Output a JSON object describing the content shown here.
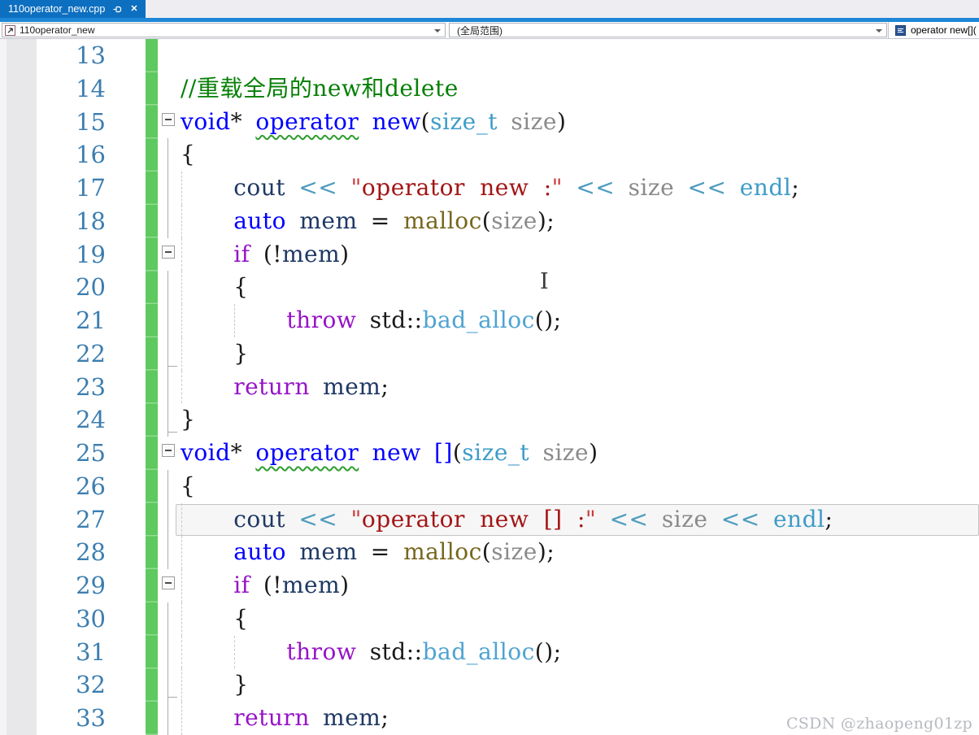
{
  "tab": {
    "title": "110operator_new.cpp",
    "pin_icon": "pin-icon",
    "close_icon": "✕"
  },
  "navbar": {
    "types_combo": {
      "value": "110operator_new",
      "icon": "cpp-file-icon"
    },
    "scope_combo": {
      "value": "(全局范围)"
    },
    "member_combo": {
      "value": "operator new[](",
      "icon": "method-icon"
    }
  },
  "watermark": {
    "text": "CSDN @zhaopeng01zp"
  },
  "colors": {
    "tab_blue": "#0D6FC0",
    "strip_blue": "#1E87D7",
    "change_bar_green": "#5EC95E",
    "line_number": "#3C7EB0",
    "keyword": "#0000FF",
    "control_keyword": "#9614C8",
    "type": "#3E9CC8",
    "class_name": "#4FA3D1",
    "parameter": "#8A8A8A",
    "variable": "#1F3864",
    "function": "#77661E",
    "operator": "#4E9CBF",
    "string": "#A31515",
    "quote": "#CC3B3B",
    "punctuation": "#1A1A1A",
    "comment": "#067F06",
    "squiggle": "#2E9E2E",
    "watermark": "#B7BAC0"
  },
  "editor": {
    "lines": [
      {
        "num": 13,
        "fold": "",
        "guides": [],
        "current": false,
        "tokens": []
      },
      {
        "num": 14,
        "fold": "",
        "guides": [],
        "current": false,
        "tokens": [
          {
            "t": "//重载全局的new和delete",
            "c": "com"
          }
        ]
      },
      {
        "num": 15,
        "fold": "box",
        "guides": [],
        "current": false,
        "tokens": [
          {
            "t": "void",
            "c": "kw"
          },
          {
            "t": "*",
            "c": "pun"
          },
          {
            "w": 1
          },
          {
            "t": "operator",
            "c": "kw",
            "u": true
          },
          {
            "w": 1
          },
          {
            "t": "new",
            "c": "kw"
          },
          {
            "t": "(",
            "c": "pun"
          },
          {
            "t": "size_t",
            "c": "type"
          },
          {
            "w": 1
          },
          {
            "t": "size",
            "c": "param"
          },
          {
            "t": ")",
            "c": "pun"
          }
        ]
      },
      {
        "num": 16,
        "fold": "line",
        "guides": [],
        "current": false,
        "tokens": [
          {
            "t": "{",
            "c": "pun"
          }
        ]
      },
      {
        "num": 17,
        "fold": "line",
        "guides": [
          1
        ],
        "current": false,
        "tokens": [
          {
            "w": 4
          },
          {
            "t": "cout",
            "c": "var"
          },
          {
            "w": 1
          },
          {
            "t": "<<",
            "c": "op"
          },
          {
            "w": 1
          },
          {
            "t": "\"",
            "c": "quo"
          },
          {
            "t": "operator new :",
            "c": "str"
          },
          {
            "t": "\"",
            "c": "quo"
          },
          {
            "w": 1
          },
          {
            "t": "<<",
            "c": "op"
          },
          {
            "w": 1
          },
          {
            "t": "size",
            "c": "param"
          },
          {
            "w": 1
          },
          {
            "t": "<<",
            "c": "op"
          },
          {
            "w": 1
          },
          {
            "t": "endl",
            "c": "type"
          },
          {
            "t": ";",
            "c": "pun"
          }
        ]
      },
      {
        "num": 18,
        "fold": "line",
        "guides": [
          1
        ],
        "current": false,
        "tokens": [
          {
            "w": 4
          },
          {
            "t": "auto",
            "c": "kw"
          },
          {
            "w": 1
          },
          {
            "t": "mem",
            "c": "var"
          },
          {
            "w": 1
          },
          {
            "t": "=",
            "c": "pun"
          },
          {
            "w": 1
          },
          {
            "t": "malloc",
            "c": "fn"
          },
          {
            "t": "(",
            "c": "pun"
          },
          {
            "t": "size",
            "c": "param"
          },
          {
            "t": ")",
            "c": "pun"
          },
          {
            "t": ";",
            "c": "pun"
          }
        ]
      },
      {
        "num": 19,
        "fold": "box",
        "guides": [
          1
        ],
        "current": false,
        "tokens": [
          {
            "w": 4
          },
          {
            "t": "if",
            "c": "ctl"
          },
          {
            "w": 1
          },
          {
            "t": "(!",
            "c": "pun"
          },
          {
            "t": "mem",
            "c": "var"
          },
          {
            "t": ")",
            "c": "pun"
          }
        ]
      },
      {
        "num": 20,
        "fold": "line",
        "guides": [
          1
        ],
        "current": false,
        "tokens": [
          {
            "w": 4
          },
          {
            "t": "{",
            "c": "pun"
          }
        ]
      },
      {
        "num": 21,
        "fold": "line",
        "guides": [
          1,
          2
        ],
        "current": false,
        "tokens": [
          {
            "w": 8
          },
          {
            "t": "throw",
            "c": "ctl"
          },
          {
            "w": 1
          },
          {
            "t": "std",
            "c": "pun"
          },
          {
            "t": "::",
            "c": "pun"
          },
          {
            "t": "bad_alloc",
            "c": "cls"
          },
          {
            "t": "()",
            "c": "pun"
          },
          {
            "t": ";",
            "c": "pun"
          }
        ]
      },
      {
        "num": 22,
        "fold": "end",
        "guides": [
          1
        ],
        "current": false,
        "tokens": [
          {
            "w": 4
          },
          {
            "t": "}",
            "c": "pun"
          }
        ]
      },
      {
        "num": 23,
        "fold": "line",
        "guides": [
          1
        ],
        "current": false,
        "tokens": [
          {
            "w": 4
          },
          {
            "t": "return",
            "c": "ctl"
          },
          {
            "w": 1
          },
          {
            "t": "mem",
            "c": "var"
          },
          {
            "t": ";",
            "c": "pun"
          }
        ]
      },
      {
        "num": 24,
        "fold": "end",
        "guides": [],
        "current": false,
        "tokens": [
          {
            "t": "}",
            "c": "pun"
          }
        ]
      },
      {
        "num": 25,
        "fold": "box",
        "guides": [],
        "current": false,
        "tokens": [
          {
            "t": "void",
            "c": "kw"
          },
          {
            "t": "*",
            "c": "pun"
          },
          {
            "w": 1
          },
          {
            "t": "operator",
            "c": "kw",
            "u": true
          },
          {
            "w": 1
          },
          {
            "t": "new",
            "c": "kw"
          },
          {
            "w": 1
          },
          {
            "t": "[]",
            "c": "kw"
          },
          {
            "t": "(",
            "c": "pun"
          },
          {
            "t": "size_t",
            "c": "type"
          },
          {
            "w": 1
          },
          {
            "t": "size",
            "c": "param"
          },
          {
            "t": ")",
            "c": "pun"
          }
        ]
      },
      {
        "num": 26,
        "fold": "line",
        "guides": [],
        "current": false,
        "tokens": [
          {
            "t": "{",
            "c": "pun"
          }
        ]
      },
      {
        "num": 27,
        "fold": "line",
        "guides": [
          1
        ],
        "current": true,
        "tokens": [
          {
            "w": 4
          },
          {
            "t": "cout",
            "c": "var"
          },
          {
            "w": 1
          },
          {
            "t": "<<",
            "c": "op"
          },
          {
            "w": 1
          },
          {
            "t": "\"",
            "c": "quo"
          },
          {
            "t": "operator new [] :",
            "c": "str"
          },
          {
            "t": "\"",
            "c": "quo"
          },
          {
            "w": 1
          },
          {
            "t": "<<",
            "c": "op"
          },
          {
            "w": 1
          },
          {
            "t": "size",
            "c": "param"
          },
          {
            "w": 1
          },
          {
            "t": "<<",
            "c": "op"
          },
          {
            "w": 1
          },
          {
            "t": "endl",
            "c": "type"
          },
          {
            "t": ";",
            "c": "pun"
          }
        ]
      },
      {
        "num": 28,
        "fold": "line",
        "guides": [
          1
        ],
        "current": false,
        "tokens": [
          {
            "w": 4
          },
          {
            "t": "auto",
            "c": "kw"
          },
          {
            "w": 1
          },
          {
            "t": "mem",
            "c": "var"
          },
          {
            "w": 1
          },
          {
            "t": "=",
            "c": "pun"
          },
          {
            "w": 1
          },
          {
            "t": "malloc",
            "c": "fn"
          },
          {
            "t": "(",
            "c": "pun"
          },
          {
            "t": "size",
            "c": "param"
          },
          {
            "t": ")",
            "c": "pun"
          },
          {
            "t": ";",
            "c": "pun"
          }
        ]
      },
      {
        "num": 29,
        "fold": "box",
        "guides": [
          1
        ],
        "current": false,
        "tokens": [
          {
            "w": 4
          },
          {
            "t": "if",
            "c": "ctl"
          },
          {
            "w": 1
          },
          {
            "t": "(!",
            "c": "pun"
          },
          {
            "t": "mem",
            "c": "var"
          },
          {
            "t": ")",
            "c": "pun"
          }
        ]
      },
      {
        "num": 30,
        "fold": "line",
        "guides": [
          1
        ],
        "current": false,
        "tokens": [
          {
            "w": 4
          },
          {
            "t": "{",
            "c": "pun"
          }
        ]
      },
      {
        "num": 31,
        "fold": "line",
        "guides": [
          1,
          2
        ],
        "current": false,
        "tokens": [
          {
            "w": 8
          },
          {
            "t": "throw",
            "c": "ctl"
          },
          {
            "w": 1
          },
          {
            "t": "std",
            "c": "pun"
          },
          {
            "t": "::",
            "c": "pun"
          },
          {
            "t": "bad_alloc",
            "c": "cls"
          },
          {
            "t": "()",
            "c": "pun"
          },
          {
            "t": ";",
            "c": "pun"
          }
        ]
      },
      {
        "num": 32,
        "fold": "end",
        "guides": [
          1
        ],
        "current": false,
        "tokens": [
          {
            "w": 4
          },
          {
            "t": "}",
            "c": "pun"
          }
        ]
      },
      {
        "num": 33,
        "fold": "line",
        "guides": [
          1
        ],
        "current": false,
        "tokens": [
          {
            "w": 4
          },
          {
            "t": "return",
            "c": "ctl"
          },
          {
            "w": 1
          },
          {
            "t": "mem",
            "c": "var"
          },
          {
            "t": ";",
            "c": "pun"
          }
        ]
      }
    ]
  }
}
